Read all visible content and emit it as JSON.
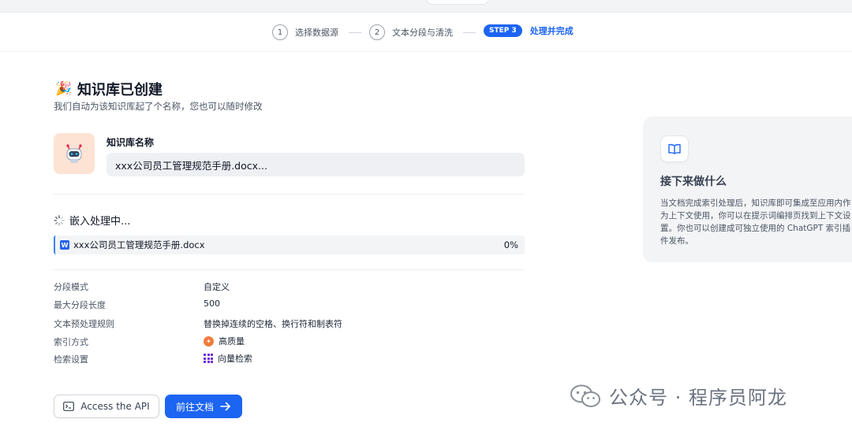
{
  "steps": [
    {
      "num": "1",
      "label": "选择数据源"
    },
    {
      "num": "2",
      "label": "文本分段与清洗"
    },
    {
      "num": "STEP 3",
      "label": "处理并完成"
    }
  ],
  "header": {
    "title": "知识库已创建",
    "subtitle": "我们自动为该知识库起了个名称，您也可以随时修改"
  },
  "kb": {
    "name_label": "知识库名称",
    "name_value": "xxx公司员工管理规范手册.docx..."
  },
  "embedding": {
    "status": "嵌入处理中...",
    "file_name": "xxx公司员工管理规范手册.docx",
    "progress": "0%"
  },
  "settings": [
    {
      "label": "分段模式",
      "value": "自定义"
    },
    {
      "label": "最大分段长度",
      "value": "500"
    },
    {
      "label": "文本预处理规则",
      "value": "替换掉连续的空格、换行符和制表符"
    },
    {
      "label": "索引方式",
      "value": "高质量",
      "icon": "high-quality-icon"
    },
    {
      "label": "检索设置",
      "value": "向量检索",
      "icon": "vector-grid-icon"
    }
  ],
  "buttons": {
    "api": "Access the API",
    "docs": "前往文档"
  },
  "next": {
    "title": "接下来做什么",
    "lines": [
      "当文档完成索引处理后，知识库即可集成至应用内作",
      "为上下文使用，你可以在提示词编排页找到上下文设",
      "置。你也可以创建成可独立使用的 ChatGPT 索引插",
      "件发布。"
    ]
  },
  "watermark": {
    "text": "公众号 · 程序员阿龙"
  },
  "colors": {
    "primary": "#1c64f2",
    "avatar_bg": "#fde3d3",
    "hq_orange": "#f07c3c",
    "vector_purple": "#6d28d9"
  }
}
